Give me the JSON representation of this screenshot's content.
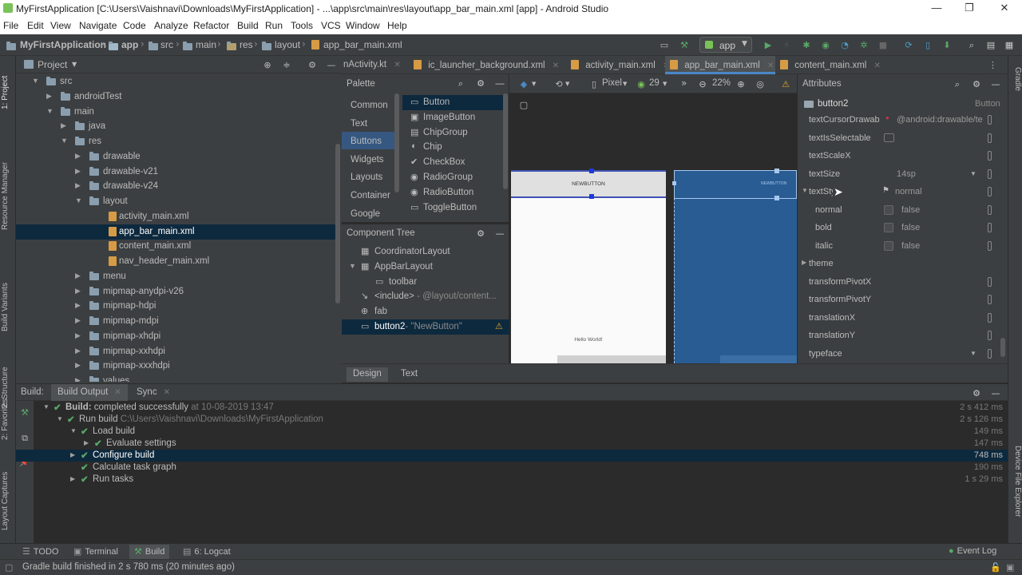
{
  "window": {
    "title": "MyFirstApplication [C:\\Users\\Vaishnavi\\Downloads\\MyFirstApplication] - ...\\app\\src\\main\\res\\layout\\app_bar_main.xml [app] - Android Studio"
  },
  "menu": [
    "File",
    "Edit",
    "View",
    "Navigate",
    "Code",
    "Analyze",
    "Refactor",
    "Build",
    "Run",
    "Tools",
    "VCS",
    "Window",
    "Help"
  ],
  "breadcrumbs": [
    "MyFirstApplication",
    "app",
    "src",
    "main",
    "res",
    "layout",
    "app_bar_main.xml"
  ],
  "toolbar": {
    "run_config": "app"
  },
  "left_tabs": [
    "1: Project",
    "Resource Manager",
    "Build Variants",
    "2: Structure",
    "2: Favorites",
    "Layout Captures"
  ],
  "right_tabs": [
    "Gradle",
    "Device File Explorer"
  ],
  "project": {
    "view_label": "Project",
    "tree": [
      {
        "label": "src",
        "indent": 2,
        "arrow": "open",
        "icon": "folder"
      },
      {
        "label": "androidTest",
        "indent": 3,
        "arrow": "closed",
        "icon": "folder"
      },
      {
        "label": "main",
        "indent": 3,
        "arrow": "open",
        "icon": "folder"
      },
      {
        "label": "java",
        "indent": 4,
        "arrow": "closed",
        "icon": "folder"
      },
      {
        "label": "res",
        "indent": 4,
        "arrow": "open",
        "icon": "folder"
      },
      {
        "label": "drawable",
        "indent": 5,
        "arrow": "closed",
        "icon": "folder"
      },
      {
        "label": "drawable-v21",
        "indent": 5,
        "arrow": "closed",
        "icon": "folder"
      },
      {
        "label": "drawable-v24",
        "indent": 5,
        "arrow": "closed",
        "icon": "folder"
      },
      {
        "label": "layout",
        "indent": 5,
        "arrow": "open",
        "icon": "folder"
      },
      {
        "label": "activity_main.xml",
        "indent": 6,
        "arrow": "",
        "icon": "xml"
      },
      {
        "label": "app_bar_main.xml",
        "indent": 6,
        "arrow": "",
        "icon": "xml",
        "selected": true
      },
      {
        "label": "content_main.xml",
        "indent": 6,
        "arrow": "",
        "icon": "xml"
      },
      {
        "label": "nav_header_main.xml",
        "indent": 6,
        "arrow": "",
        "icon": "xml"
      },
      {
        "label": "menu",
        "indent": 5,
        "arrow": "closed",
        "icon": "folder"
      },
      {
        "label": "mipmap-anydpi-v26",
        "indent": 5,
        "arrow": "closed",
        "icon": "folder"
      },
      {
        "label": "mipmap-hdpi",
        "indent": 5,
        "arrow": "closed",
        "icon": "folder"
      },
      {
        "label": "mipmap-mdpi",
        "indent": 5,
        "arrow": "closed",
        "icon": "folder"
      },
      {
        "label": "mipmap-xhdpi",
        "indent": 5,
        "arrow": "closed",
        "icon": "folder"
      },
      {
        "label": "mipmap-xxhdpi",
        "indent": 5,
        "arrow": "closed",
        "icon": "folder"
      },
      {
        "label": "mipmap-xxxhdpi",
        "indent": 5,
        "arrow": "closed",
        "icon": "folder"
      },
      {
        "label": "values",
        "indent": 5,
        "arrow": "closed",
        "icon": "folder"
      }
    ]
  },
  "editor_tabs": [
    {
      "label": "nActivity.kt",
      "active": false
    },
    {
      "label": "ic_launcher_background.xml",
      "active": false
    },
    {
      "label": "activity_main.xml",
      "active": false
    },
    {
      "label": "app_bar_main.xml",
      "active": true
    },
    {
      "label": "content_main.xml",
      "active": false
    }
  ],
  "palette": {
    "title": "Palette",
    "categories": [
      "Common",
      "Text",
      "Buttons",
      "Widgets",
      "Layouts",
      "Container",
      "Google"
    ],
    "selected_category": "Buttons",
    "items": [
      "Button",
      "ImageButton",
      "ChipGroup",
      "Chip",
      "CheckBox",
      "RadioGroup",
      "RadioButton",
      "ToggleButton"
    ],
    "selected_item": "Button"
  },
  "component_tree": {
    "title": "Component Tree",
    "rows": [
      {
        "label": "CoordinatorLayout",
        "indent": 0,
        "arrow": ""
      },
      {
        "label": "AppBarLayout",
        "indent": 0,
        "arrow": "open"
      },
      {
        "label": "toolbar",
        "indent": 1,
        "arrow": ""
      },
      {
        "label": "<include>",
        "suffix": " - @layout/content...",
        "indent": 0,
        "arrow": ""
      },
      {
        "label": "fab",
        "indent": 0,
        "arrow": ""
      },
      {
        "label": "button2",
        "suffix": "- \"NewButton\"",
        "indent": 0,
        "arrow": "",
        "selected": true,
        "warning": true
      }
    ]
  },
  "design_toolbar": {
    "device": "Pixel",
    "api": "29",
    "zoom": "22%"
  },
  "canvas": {
    "button_text": "NEWBUTTON",
    "blueprint_button_text": "NEWBUTTON",
    "hello": "Hello World!"
  },
  "attributes": {
    "title": "Attributes",
    "component": "button2",
    "component_type": "Button",
    "rows": [
      {
        "key": "textCursorDrawab",
        "value": "@android:drawable/te",
        "kind": "value"
      },
      {
        "key": "textIsSelectable",
        "value": "",
        "kind": "toggle"
      },
      {
        "key": "textScaleX",
        "value": "",
        "kind": "text"
      },
      {
        "key": "textSize",
        "value": "14sp",
        "kind": "dropdown"
      },
      {
        "key": "textStyle",
        "value": "normal",
        "kind": "group"
      },
      {
        "key": "normal",
        "value": "false",
        "kind": "check"
      },
      {
        "key": "bold",
        "value": "false",
        "kind": "check"
      },
      {
        "key": "italic",
        "value": "false",
        "kind": "check"
      },
      {
        "key": "theme",
        "value": "",
        "kind": "collapsed"
      },
      {
        "key": "transformPivotX",
        "value": "",
        "kind": "text"
      },
      {
        "key": "transformPivotY",
        "value": "",
        "kind": "text"
      },
      {
        "key": "translationX",
        "value": "",
        "kind": "text"
      },
      {
        "key": "translationY",
        "value": "",
        "kind": "text"
      },
      {
        "key": "typeface",
        "value": "",
        "kind": "dropdown"
      }
    ]
  },
  "design_tabs": [
    "Design",
    "Text"
  ],
  "build": {
    "header_label": "Build:",
    "tabs": [
      "Build Output",
      "Sync"
    ],
    "rows": [
      {
        "bold": "Build:",
        "label": " completed successfully",
        "extra": " at 10-08-2019 13:47",
        "time": "2 s 412 ms",
        "indent": 0,
        "arrow": "open"
      },
      {
        "label": "Run build",
        "extra": " C:\\Users\\Vaishnavi\\Downloads\\MyFirstApplication",
        "time": "2 s 126 ms",
        "indent": 1,
        "arrow": "open"
      },
      {
        "label": "Load build",
        "time": "149 ms",
        "indent": 2,
        "arrow": "open"
      },
      {
        "label": "Evaluate settings",
        "time": "147 ms",
        "indent": 3,
        "arrow": "closed"
      },
      {
        "label": "Configure build",
        "time": "748 ms",
        "indent": 2,
        "arrow": "closed",
        "selected": true
      },
      {
        "label": "Calculate task graph",
        "time": "190 ms",
        "indent": 2,
        "arrow": ""
      },
      {
        "label": "Run tasks",
        "time": "1 s 29 ms",
        "indent": 2,
        "arrow": "closed"
      }
    ]
  },
  "bottom_tabs": [
    "TODO",
    "Terminal",
    "Build",
    "6: Logcat"
  ],
  "bottom_active": "Build",
  "event_log": "Event Log",
  "status": "Gradle build finished in 2 s 780 ms (20 minutes ago)",
  "colors": {
    "selection": "#0d293e",
    "accent": "#4a88c7",
    "success": "#59a869",
    "warning": "#e2a52b"
  }
}
